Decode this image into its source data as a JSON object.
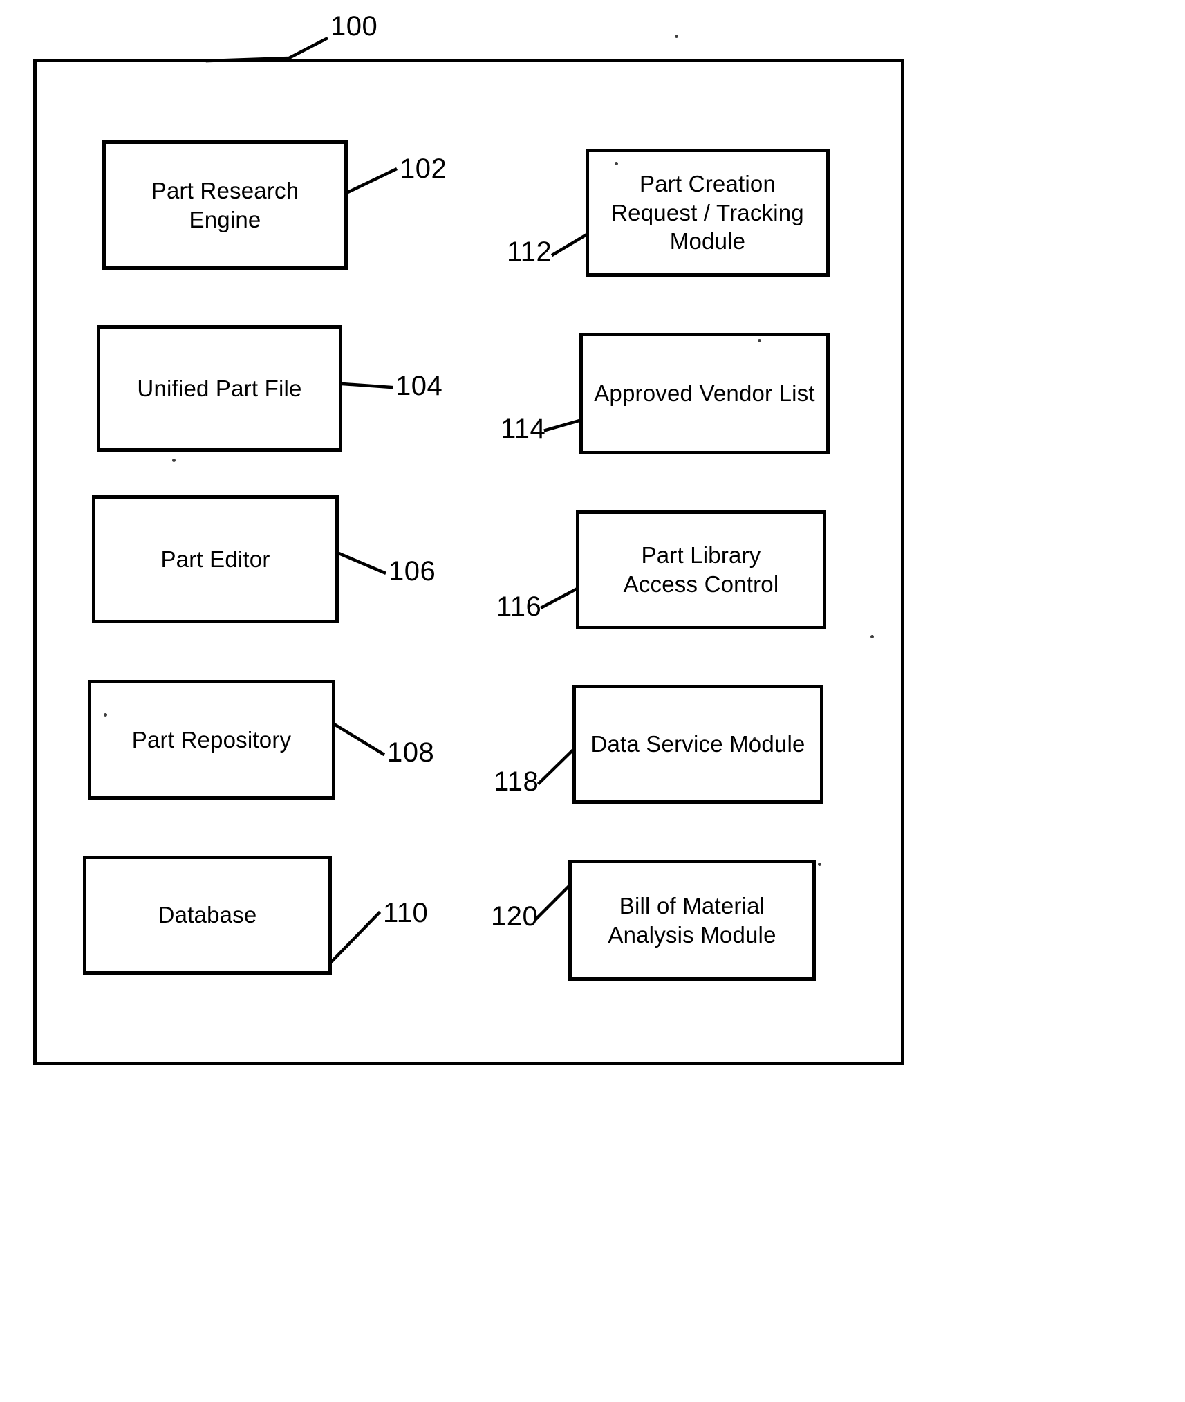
{
  "figure": {
    "system_ref": "100",
    "background_color": "#ffffff",
    "line_color": "#000000"
  },
  "left_column": [
    {
      "label": "Part Research\nEngine",
      "ref": "102"
    },
    {
      "label": "Unified Part File",
      "ref": "104"
    },
    {
      "label": "Part Editor",
      "ref": "106"
    },
    {
      "label": "Part Repository",
      "ref": "108"
    },
    {
      "label": "Database",
      "ref": "110"
    }
  ],
  "right_column": [
    {
      "label": "Part Creation\nRequest / Tracking\nModule",
      "ref": "112"
    },
    {
      "label": "Approved Vendor List",
      "ref": "114"
    },
    {
      "label": "Part Library\nAccess Control",
      "ref": "116"
    },
    {
      "label": "Data Service Module",
      "ref": "118"
    },
    {
      "label": "Bill of Material\nAnalysis Module",
      "ref": "120"
    }
  ]
}
